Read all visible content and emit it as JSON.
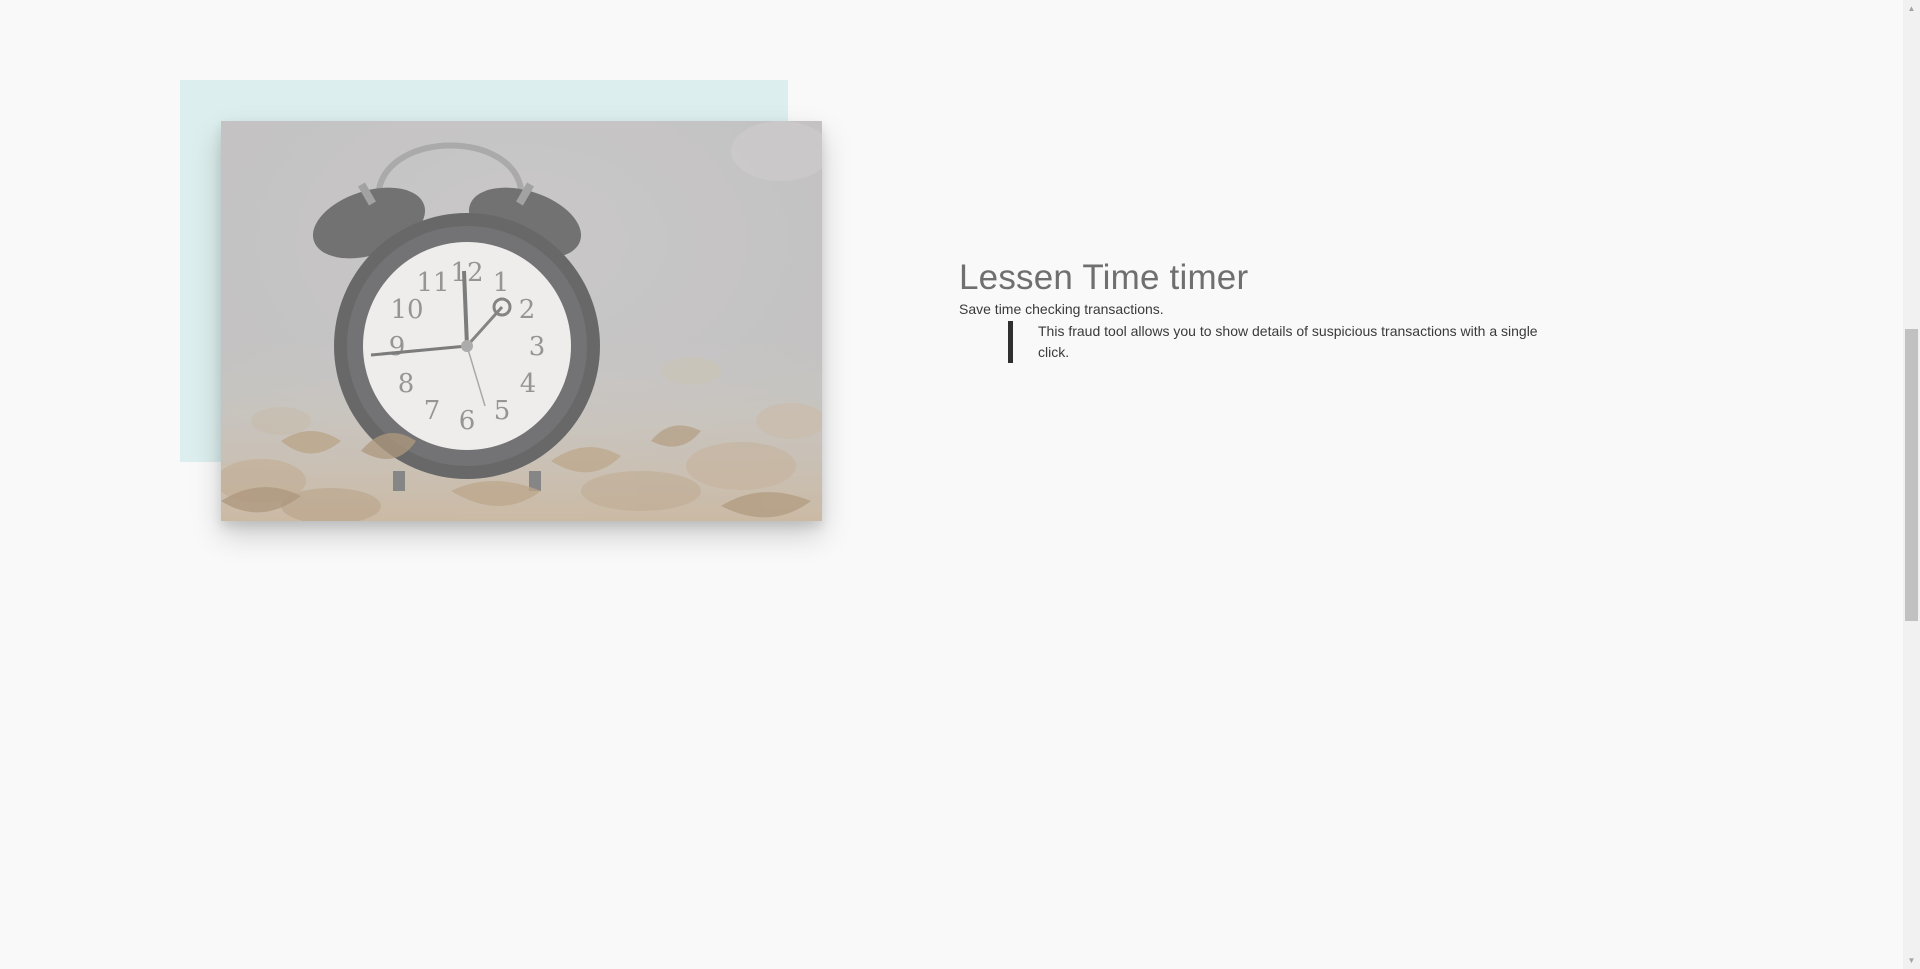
{
  "feature": {
    "title": "Lessen Time timer",
    "subtitle": "Save time checking transactions.",
    "quote": "This fraud tool allows you to show details of suspicious transactions with a single click."
  },
  "image": {
    "subject": "alarm-clock",
    "clock_numbers": [
      "12",
      "1",
      "2",
      "3",
      "4",
      "5",
      "6",
      "7",
      "8",
      "9",
      "10",
      "11"
    ]
  },
  "scrollbar": {
    "up_arrow": "▲",
    "down_arrow": "▼"
  },
  "colors": {
    "background": "#f9f9f9",
    "accent_block": "#dceeed",
    "heading": "#6f6f6f",
    "body_text": "#3a3a3a",
    "quote_border": "#2f2f2f"
  }
}
